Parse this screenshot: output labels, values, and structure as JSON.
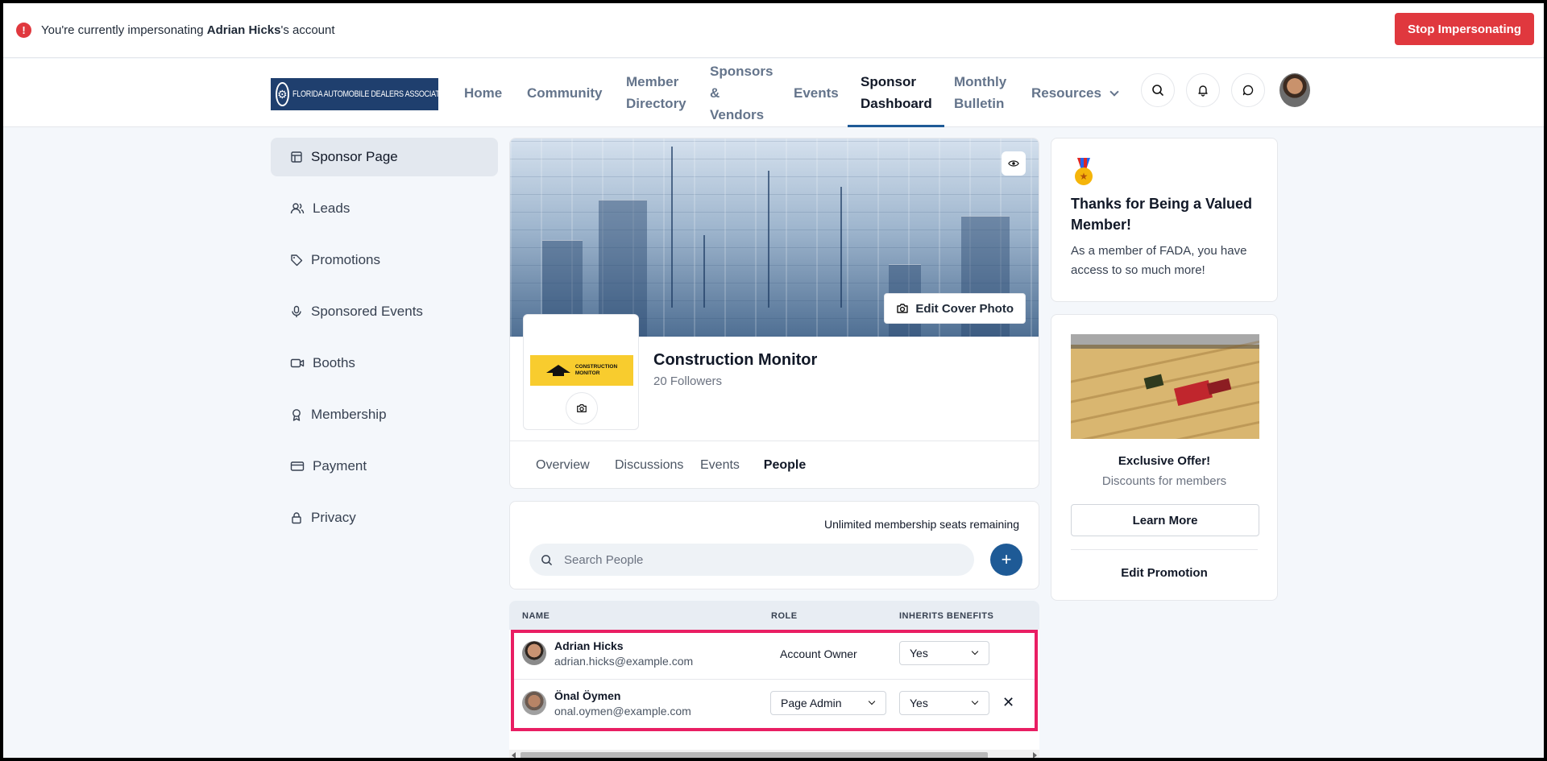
{
  "impersonation": {
    "prefix": "You're currently impersonating ",
    "user": "Adrian Hicks",
    "suffix": "'s account",
    "stop_label": "Stop Impersonating"
  },
  "nav": {
    "logo_text": "FLORIDA AUTOMOBILE DEALERS ASSOCIATION",
    "items": {
      "home": "Home",
      "community": "Community",
      "member_1": "Member",
      "member_2": "Directory",
      "sponsors_1": "Sponsors",
      "sponsors_2": "&",
      "sponsors_3": "Vendors",
      "events": "Events",
      "dashboard_1": "Sponsor",
      "dashboard_2": "Dashboard",
      "bulletin_1": "Monthly",
      "bulletin_2": "Bulletin",
      "resources": "Resources"
    },
    "active": "Sponsor Dashboard"
  },
  "sidebar": {
    "items": [
      {
        "label": "Sponsor Page",
        "icon": "layout-icon"
      },
      {
        "label": "Leads",
        "icon": "users-icon"
      },
      {
        "label": "Promotions",
        "icon": "tag-icon"
      },
      {
        "label": "Sponsored Events",
        "icon": "microphone-icon"
      },
      {
        "label": "Booths",
        "icon": "video-icon"
      },
      {
        "label": "Membership",
        "icon": "award-icon"
      },
      {
        "label": "Payment",
        "icon": "credit-card-icon"
      },
      {
        "label": "Privacy",
        "icon": "lock-icon"
      }
    ]
  },
  "profile": {
    "edit_cover_label": "Edit Cover Photo",
    "logo_text_1": "CONSTRUCTION",
    "logo_text_2": "MONITOR",
    "company_name": "Construction Monitor",
    "followers": "20 Followers",
    "tabs": [
      "Overview",
      "Discussions",
      "Events",
      "People"
    ],
    "active_tab": "People"
  },
  "people": {
    "seats_text": "Unlimited membership seats remaining",
    "search_placeholder": "Search People",
    "add_label": "+",
    "columns": {
      "name": "NAME",
      "role": "ROLE",
      "inherits": "INHERITS BENEFITS"
    },
    "rows": [
      {
        "name": "Adrian Hicks",
        "email": "adrian.hicks@example.com",
        "role": "Account Owner",
        "inherits": "Yes"
      },
      {
        "name": "Önal Öymen",
        "email": "onal.oymen@example.com",
        "role": "Page Admin",
        "inherits": "Yes"
      }
    ],
    "remove_label": "✕"
  },
  "member_card": {
    "title": "Thanks for Being a Valued Member!",
    "desc": "As a member of FADA, you have access to so much more!"
  },
  "promo_card": {
    "title": "Exclusive Offer!",
    "subtitle": "Discounts for members",
    "learn_more": "Learn More",
    "edit_promotion": "Edit Promotion"
  },
  "colors": {
    "accent": "#1e5a96",
    "danger": "#e0383e",
    "highlight": "#e91e63"
  }
}
